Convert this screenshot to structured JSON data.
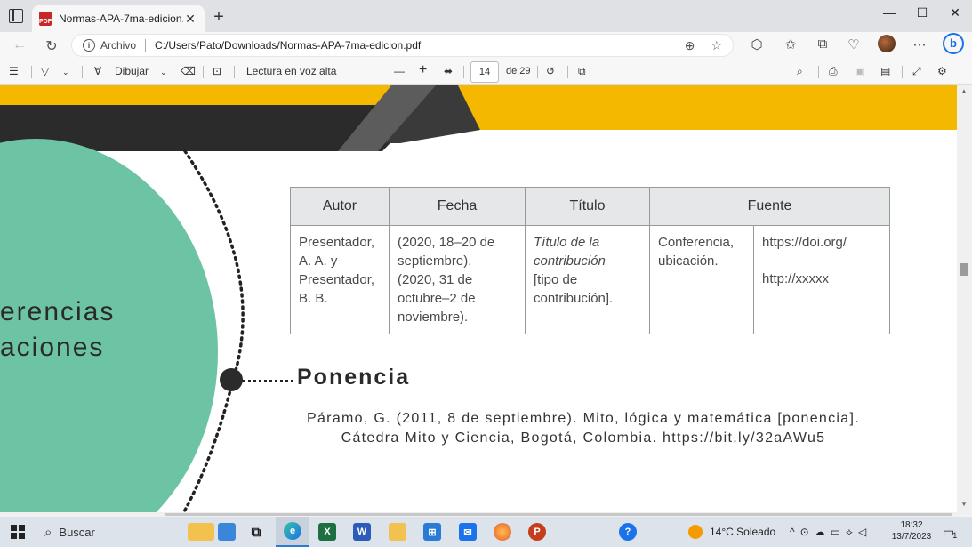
{
  "browser": {
    "tab_title": "Normas-APA-7ma-edicion.pdf",
    "new_tab": "+",
    "close_tab": "✕",
    "window_controls": {
      "minimize": "—",
      "maximize": "☐",
      "close": "✕"
    },
    "address_prefix": "Archivo",
    "url": "C:/Users/Pato/Downloads/Normas-APA-7ma-edicion.pdf"
  },
  "pdf_toolbar": {
    "draw_label": "Dibujar",
    "read_aloud": "Lectura en voz alta",
    "zoom_out": "—",
    "zoom_in": "+",
    "current_page": "14",
    "page_total": "de 29"
  },
  "document": {
    "table": {
      "headers": [
        "Autor",
        "Fecha",
        "Título",
        "Fuente"
      ],
      "author": [
        "Presentador,",
        "A. A. y",
        "Presentador,",
        "B. B."
      ],
      "date": [
        "(2020, 18–20 de",
        "septiembre).",
        "(2020, 31 de",
        "octubre–2 de",
        "noviembre)."
      ],
      "title_italic": [
        "Título de la",
        "contribución"
      ],
      "title_plain": [
        "[tipo de",
        "contribución]."
      ],
      "source_kind": [
        "Conferencia,",
        "ubicación."
      ],
      "source_links": [
        "https://doi.org/",
        "http://xxxxx"
      ]
    },
    "side_text": [
      "erencias",
      "aciones"
    ],
    "section_title": "Ponencia",
    "reference_lines": [
      "Páramo, G. (2011, 8 de septiembre). Mito, lógica y matemática [ponencia].",
      "Cátedra Mito y Ciencia, Bogotá, Colombia. https://bit.ly/32aAWu5"
    ]
  },
  "taskbar": {
    "search_label": "Buscar",
    "weather": "14°C  Soleado",
    "time": "18:32",
    "date": "13/7/2023",
    "notification_count": "1"
  },
  "colors": {
    "banner_yellow": "#f5b800",
    "banner_dark": "#2b2b2b",
    "teal": "#6cc4a4"
  }
}
